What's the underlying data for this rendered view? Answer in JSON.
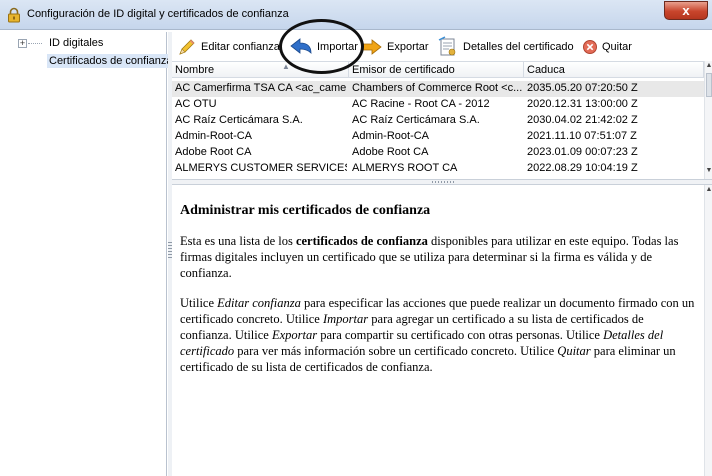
{
  "window": {
    "title": "Configuración de ID digital y certificados de confianza",
    "close_glyph": "x"
  },
  "sidebar": {
    "items": [
      {
        "label": "ID digitales",
        "expander": "+",
        "selected": false
      },
      {
        "label": "Certificados de confianza",
        "selected": true
      }
    ]
  },
  "toolbar": {
    "edit_label": "Editar confianza",
    "import_label": "Importar",
    "export_label": "Exportar",
    "details_label": "Detalles del certificado",
    "remove_label": "Quitar"
  },
  "table": {
    "columns": [
      "Nombre",
      "Emisor de certificado",
      "Caduca"
    ],
    "rows": [
      [
        "AC Camerfirma TSA CA <ac_came...",
        "Chambers of Commerce Root <c...",
        "2035.05.20 07:20:50 Z"
      ],
      [
        "AC OTU",
        "AC Racine - Root CA - 2012",
        "2020.12.31 13:00:00 Z"
      ],
      [
        "AC Raíz Certicámara S.A.",
        "AC Raíz Certicámara S.A.",
        "2030.04.02 21:42:02 Z"
      ],
      [
        "Admin-Root-CA",
        "Admin-Root-CA",
        "2021.11.10 07:51:07 Z"
      ],
      [
        "Adobe Root CA",
        "Adobe Root CA",
        "2023.01.09 00:07:23 Z"
      ],
      [
        "ALMERYS CUSTOMER SERVICES C...",
        "ALMERYS ROOT CA",
        "2022.08.29 10:04:19 Z"
      ]
    ]
  },
  "description": {
    "heading": "Administrar mis certificados de confianza",
    "p1": {
      "t1": "Esta es una lista de los ",
      "b1": "certificados de confianza",
      "t2": " disponibles para utilizar en este equipo. Todas las firmas digitales incluyen un certificado que se utiliza para determinar si la firma es válida y de confianza."
    },
    "p2": {
      "t1": "Utilice ",
      "i1": "Editar confianza",
      "t2": " para especificar las acciones que puede realizar un documento firmado con un certificado concreto. Utilice ",
      "i2": "Importar",
      "t3": " para agregar un certificado a su lista de certificados de confianza. Utilice ",
      "i3": "Exportar",
      "t4": " para compartir su certificado con otras personas. Utilice ",
      "i4": "Detalles del certificado",
      "t5": " para ver más información sobre un certificado concreto. Utilice ",
      "i5": "Quitar",
      "t6": " para eliminar un certificado de su lista de certificados de confianza."
    }
  },
  "colors": {
    "selection": "#d9e6f7",
    "row_selected": "#e8e8e8",
    "close_button": "#c8452c"
  },
  "icons": [
    "lock-icon",
    "pencil-icon",
    "import-arrow-icon",
    "export-arrow-icon",
    "certificate-details-icon",
    "remove-icon"
  ]
}
